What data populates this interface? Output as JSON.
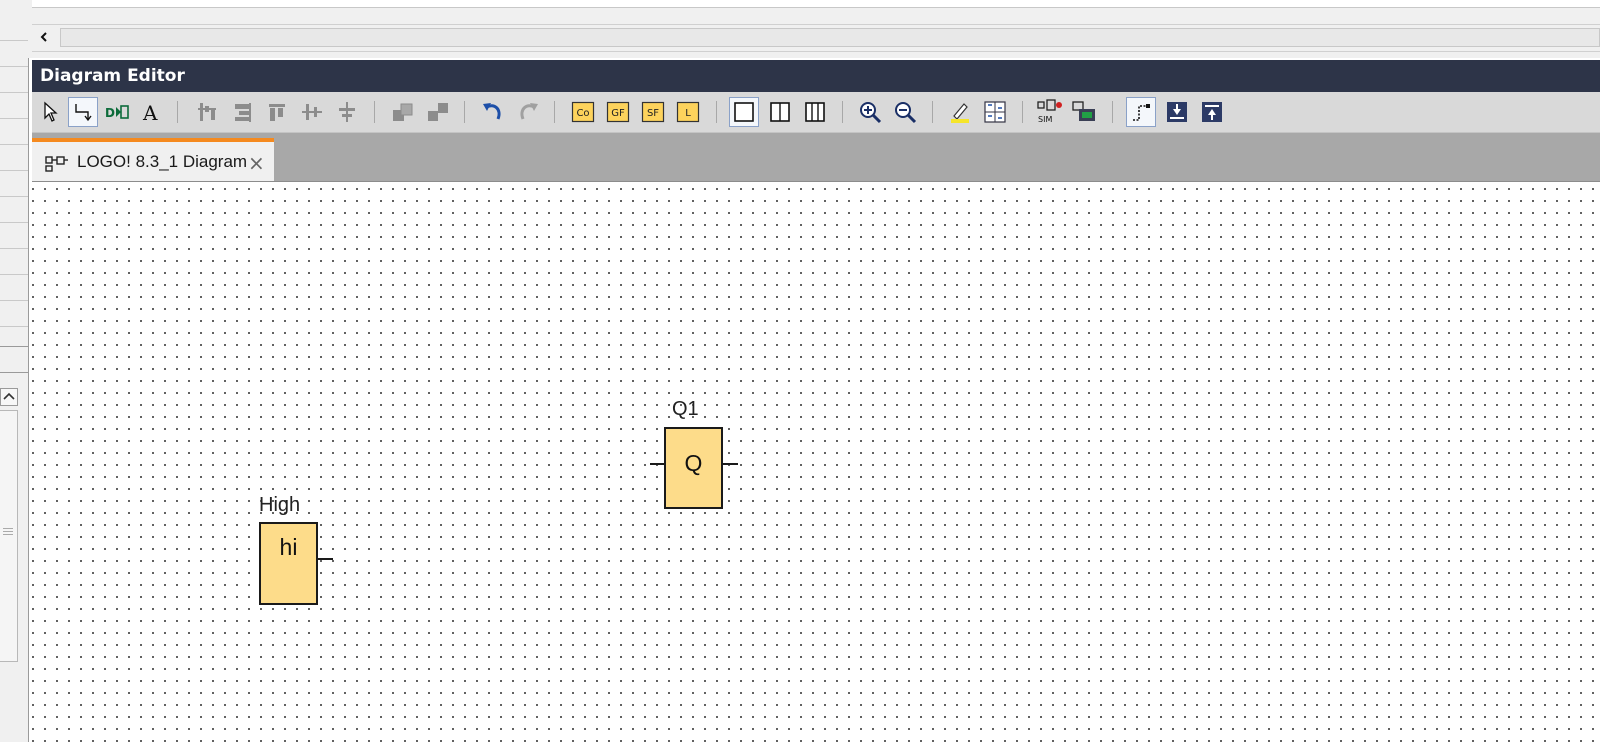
{
  "editor": {
    "title": "Diagram Editor"
  },
  "toolbar": {
    "groups": [
      [
        "select-arrow",
        "connect-tool",
        "block-tool",
        "text-tool"
      ],
      [
        "align-vertical",
        "align-right",
        "align-top",
        "distribute-horizontal",
        "distribute-vertical"
      ],
      [
        "group",
        "ungroup"
      ],
      [
        "undo",
        "redo"
      ],
      [
        "constants-co",
        "basic-functions-gf",
        "special-functions-sf",
        "logic-l"
      ],
      [
        "single-window",
        "split-two",
        "split-three"
      ],
      [
        "zoom-in",
        "zoom-out"
      ],
      [
        "highlight",
        "numbering"
      ],
      [
        "simulation",
        "online-test"
      ],
      [
        "connection-mode",
        "download",
        "upload"
      ]
    ],
    "labels": {
      "co": "Co",
      "gf": "GF",
      "sf": "SF",
      "l": "L",
      "sim": "SIM",
      "text": "A"
    }
  },
  "tab": {
    "label": "LOGO! 8.3_1 Diagram",
    "close": "×"
  },
  "blocks": [
    {
      "name": "high-block",
      "caption": "High",
      "symbol": "hi"
    },
    {
      "name": "q1-output-block",
      "caption": "Q1",
      "symbol": "Q"
    }
  ],
  "colors": {
    "title_bar": "#2d3448",
    "toolbar": "#d9d9d9",
    "tab_accent": "#f58a1f",
    "block_fill": "#fddc8a",
    "tab_strip": "#a8a8a8"
  }
}
